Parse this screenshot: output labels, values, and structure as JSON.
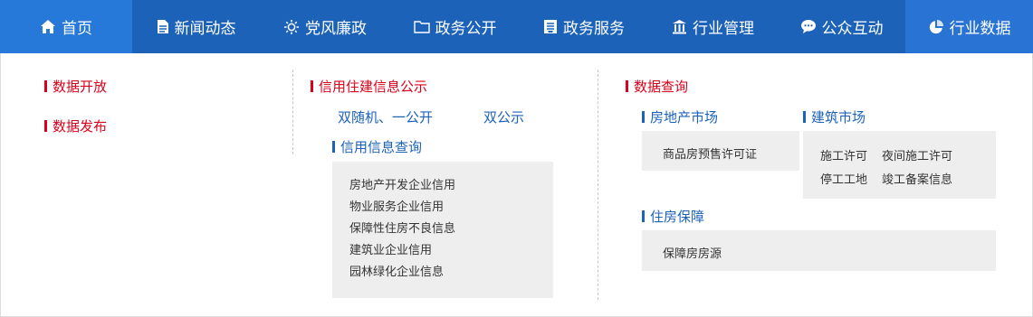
{
  "nav": {
    "items": [
      {
        "label": "首页",
        "icon": "home-icon"
      },
      {
        "label": "新闻动态",
        "icon": "document-icon"
      },
      {
        "label": "党风廉政",
        "icon": "sun-icon"
      },
      {
        "label": "政务公开",
        "icon": "folder-icon"
      },
      {
        "label": "政务服务",
        "icon": "clipboard-icon"
      },
      {
        "label": "行业管理",
        "icon": "building-icon"
      },
      {
        "label": "公众互动",
        "icon": "chat-bubble-icon"
      },
      {
        "label": "行业数据",
        "icon": "pie-chart-icon"
      }
    ]
  },
  "dropdown": {
    "col1": {
      "items": [
        "数据开放",
        "数据发布"
      ]
    },
    "col2": {
      "heading": "信用住建信息公示",
      "links": [
        "双随机、一公开",
        "双公示"
      ],
      "sub_heading": "信用信息查询",
      "box_items": [
        "房地产开发企业信用",
        "物业服务企业信用",
        "保障性住房不良信息",
        "建筑业企业信用",
        "园林绿化企业信息"
      ]
    },
    "col3": {
      "heading": "数据查询",
      "real_estate": {
        "title": "房地产市场",
        "items": [
          "商品房预售许可证"
        ]
      },
      "construction": {
        "title": "建筑市场",
        "items": [
          "施工许可",
          "夜间施工许可",
          "停工工地",
          "竣工备案信息"
        ]
      },
      "housing": {
        "title": "住房保障",
        "items": [
          "保障房房源"
        ]
      }
    }
  },
  "colors": {
    "nav_bg": "#1c62b9",
    "nav_home_bg": "#2679d8",
    "nav_active_bg": "#2873d3",
    "accent_red": "#d9001b",
    "link_blue": "#1c62b9",
    "box_gray": "#eeeeee"
  }
}
